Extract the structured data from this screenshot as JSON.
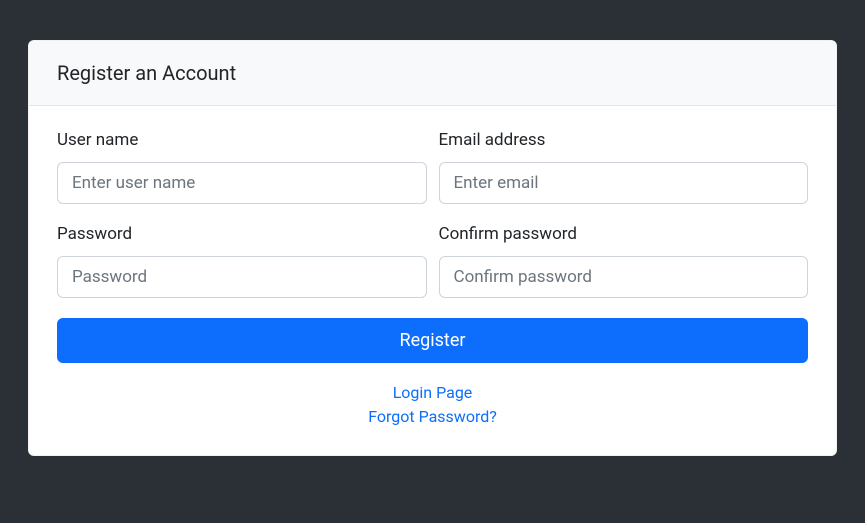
{
  "card": {
    "title": "Register an Account"
  },
  "form": {
    "username": {
      "label": "User name",
      "placeholder": "Enter user name",
      "value": ""
    },
    "email": {
      "label": "Email address",
      "placeholder": "Enter email",
      "value": ""
    },
    "password": {
      "label": "Password",
      "placeholder": "Password",
      "value": ""
    },
    "confirm": {
      "label": "Confirm password",
      "placeholder": "Confirm password",
      "value": ""
    },
    "submit_label": "Register"
  },
  "links": {
    "login": "Login Page",
    "forgot": "Forgot Password?"
  }
}
